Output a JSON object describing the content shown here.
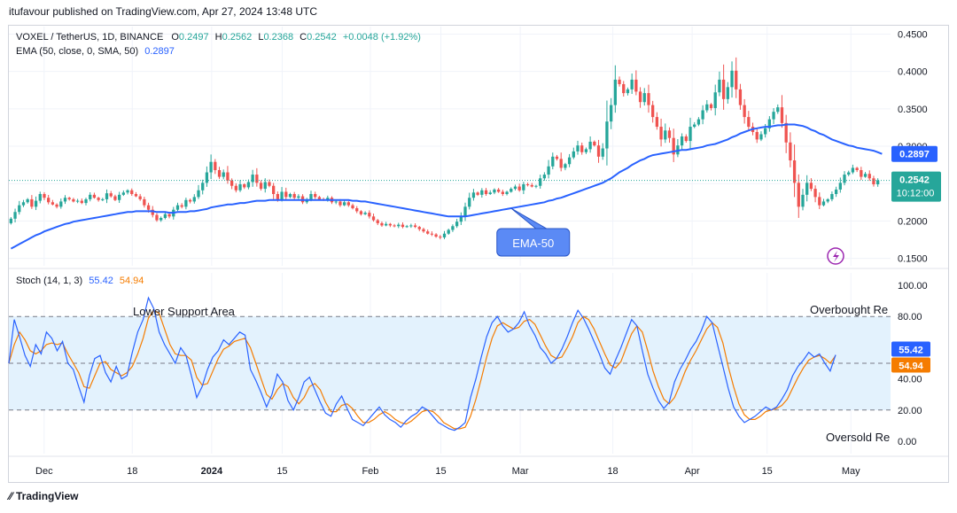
{
  "publisher": "itufavour published on TradingView.com, Apr 27, 2024 13:48 UTC",
  "footer": {
    "brand": "TradingView",
    "logo_icon": "tradingview-logo-icon"
  },
  "colors": {
    "up": "#26a69a",
    "down": "#ef5350",
    "ema": "#2962ff",
    "stoch_k": "#2962ff",
    "stoch_d": "#f57c00",
    "band_fill": "#e3f2fd"
  },
  "main_legend": {
    "symbol": "VOXEL / TetherUS, 1D, BINANCE",
    "open_label": "O",
    "open": "0.2497",
    "high_label": "H",
    "high": "0.2562",
    "low_label": "L",
    "low": "0.2368",
    "close_label": "C",
    "close": "0.2542",
    "change": "+0.0048 (+1.92%)",
    "ema_label": "EMA (50, close, 0, SMA, 50)",
    "ema_value": "0.2897"
  },
  "price_badges": {
    "ema": "0.2897",
    "last": "0.2542",
    "countdown": "10:12:00"
  },
  "annotation": {
    "ema_callout": "EMA-50"
  },
  "stoch_legend": {
    "label": "Stoch (14, 1, 3)",
    "k": "55.42",
    "d": "54.94"
  },
  "stoch_badges": {
    "k": "55.42",
    "d": "54.94"
  },
  "stoch_text": {
    "lower": "Lower Support Area",
    "overbought": "Overbought Re",
    "oversold": "Oversold Re"
  },
  "chart_data": [
    {
      "type": "candlestick",
      "title": "VOXEL / TetherUS, 1D, BINANCE",
      "y_axis": {
        "ticks": [
          "0.4500",
          "0.4000",
          "0.3500",
          "0.3000",
          "0.2500",
          "0.2000",
          "0.1500"
        ],
        "ylim": [
          0.14,
          0.46
        ]
      },
      "x_axis": {
        "ticks": [
          "Dec",
          "18",
          "2024",
          "15",
          "Feb",
          "15",
          "Mar",
          "18",
          "Apr",
          "15",
          "May"
        ]
      },
      "closes": [
        0.203,
        0.212,
        0.221,
        0.225,
        0.229,
        0.219,
        0.227,
        0.236,
        0.231,
        0.225,
        0.222,
        0.219,
        0.226,
        0.231,
        0.229,
        0.226,
        0.227,
        0.224,
        0.229,
        0.235,
        0.231,
        0.228,
        0.229,
        0.237,
        0.233,
        0.228,
        0.235,
        0.238,
        0.241,
        0.236,
        0.233,
        0.229,
        0.221,
        0.215,
        0.208,
        0.201,
        0.204,
        0.209,
        0.206,
        0.215,
        0.221,
        0.219,
        0.228,
        0.226,
        0.232,
        0.241,
        0.251,
        0.265,
        0.279,
        0.268,
        0.259,
        0.265,
        0.254,
        0.247,
        0.241,
        0.249,
        0.245,
        0.252,
        0.262,
        0.251,
        0.243,
        0.252,
        0.247,
        0.236,
        0.229,
        0.239,
        0.232,
        0.236,
        0.231,
        0.233,
        0.225,
        0.229,
        0.236,
        0.232,
        0.229,
        0.228,
        0.231,
        0.225,
        0.226,
        0.221,
        0.225,
        0.221,
        0.217,
        0.213,
        0.209,
        0.211,
        0.206,
        0.201,
        0.197,
        0.194,
        0.196,
        0.194,
        0.193,
        0.195,
        0.192,
        0.193,
        0.194,
        0.192,
        0.189,
        0.186,
        0.183,
        0.182,
        0.179,
        0.178,
        0.183,
        0.188,
        0.193,
        0.199,
        0.206,
        0.219,
        0.231,
        0.238,
        0.235,
        0.241,
        0.236,
        0.238,
        0.242,
        0.239,
        0.236,
        0.239,
        0.243,
        0.246,
        0.241,
        0.249,
        0.248,
        0.246,
        0.247,
        0.257,
        0.262,
        0.273,
        0.286,
        0.283,
        0.271,
        0.276,
        0.285,
        0.293,
        0.301,
        0.292,
        0.296,
        0.306,
        0.301,
        0.286,
        0.297,
        0.333,
        0.355,
        0.389,
        0.383,
        0.371,
        0.376,
        0.389,
        0.373,
        0.359,
        0.371,
        0.355,
        0.339,
        0.326,
        0.309,
        0.321,
        0.311,
        0.289,
        0.301,
        0.313,
        0.307,
        0.326,
        0.329,
        0.336,
        0.348,
        0.356,
        0.351,
        0.372,
        0.389,
        0.363,
        0.379,
        0.401,
        0.376,
        0.355,
        0.339,
        0.326,
        0.319,
        0.309,
        0.316,
        0.324,
        0.336,
        0.346,
        0.352,
        0.331,
        0.305,
        0.281,
        0.251,
        0.219,
        0.235,
        0.251,
        0.243,
        0.232,
        0.221,
        0.226,
        0.229,
        0.236,
        0.242,
        0.251,
        0.262,
        0.265,
        0.271,
        0.268,
        0.259,
        0.263,
        0.257,
        0.249,
        0.2542
      ],
      "ema50": [
        0.163,
        0.166,
        0.169,
        0.172,
        0.175,
        0.178,
        0.181,
        0.183,
        0.186,
        0.188,
        0.19,
        0.192,
        0.194,
        0.196,
        0.197,
        0.199,
        0.2,
        0.201,
        0.202,
        0.203,
        0.204,
        0.205,
        0.206,
        0.207,
        0.208,
        0.209,
        0.21,
        0.211,
        0.212,
        0.212,
        0.213,
        0.213,
        0.213,
        0.213,
        0.213,
        0.212,
        0.212,
        0.212,
        0.211,
        0.211,
        0.212,
        0.212,
        0.212,
        0.213,
        0.213,
        0.214,
        0.215,
        0.216,
        0.218,
        0.219,
        0.22,
        0.221,
        0.222,
        0.222,
        0.223,
        0.224,
        0.224,
        0.225,
        0.226,
        0.227,
        0.227,
        0.227,
        0.228,
        0.228,
        0.228,
        0.228,
        0.228,
        0.228,
        0.228,
        0.228,
        0.228,
        0.228,
        0.228,
        0.228,
        0.228,
        0.228,
        0.228,
        0.228,
        0.228,
        0.228,
        0.228,
        0.228,
        0.227,
        0.227,
        0.226,
        0.226,
        0.225,
        0.224,
        0.223,
        0.222,
        0.221,
        0.22,
        0.219,
        0.218,
        0.217,
        0.216,
        0.215,
        0.214,
        0.213,
        0.212,
        0.211,
        0.21,
        0.209,
        0.208,
        0.207,
        0.206,
        0.206,
        0.206,
        0.206,
        0.206,
        0.207,
        0.208,
        0.209,
        0.21,
        0.211,
        0.212,
        0.213,
        0.214,
        0.215,
        0.216,
        0.217,
        0.218,
        0.219,
        0.22,
        0.221,
        0.222,
        0.223,
        0.224,
        0.225,
        0.227,
        0.228,
        0.23,
        0.231,
        0.233,
        0.235,
        0.237,
        0.239,
        0.241,
        0.243,
        0.245,
        0.247,
        0.249,
        0.251,
        0.254,
        0.257,
        0.261,
        0.265,
        0.268,
        0.271,
        0.275,
        0.278,
        0.281,
        0.283,
        0.286,
        0.288,
        0.289,
        0.29,
        0.291,
        0.292,
        0.293,
        0.294,
        0.295,
        0.295,
        0.296,
        0.297,
        0.298,
        0.299,
        0.301,
        0.302,
        0.303,
        0.305,
        0.307,
        0.309,
        0.312,
        0.314,
        0.317,
        0.319,
        0.321,
        0.323,
        0.324,
        0.325,
        0.326,
        0.326,
        0.327,
        0.328,
        0.328,
        0.329,
        0.329,
        0.329,
        0.328,
        0.327,
        0.325,
        0.322,
        0.32,
        0.317,
        0.315,
        0.312,
        0.309,
        0.307,
        0.305,
        0.303,
        0.301,
        0.3,
        0.298,
        0.297,
        0.296,
        0.295,
        0.294,
        0.292,
        0.2897
      ]
    },
    {
      "type": "line",
      "title": "Stoch (14, 1, 3)",
      "y_axis": {
        "ticks": [
          "100.00",
          "80.00",
          "60.00",
          "40.00",
          "20.00",
          "0.00"
        ],
        "ylim": [
          -5,
          105
        ]
      },
      "bands": {
        "upper": 80,
        "middle": 50,
        "lower": 20
      },
      "series": [
        {
          "name": "K",
          "values": [
            50,
            78,
            67,
            55,
            48,
            62,
            56,
            70,
            66,
            58,
            64,
            50,
            46,
            35,
            25,
            42,
            53,
            55,
            44,
            38,
            48,
            40,
            42,
            57,
            70,
            78,
            92,
            85,
            70,
            62,
            56,
            50,
            60,
            55,
            42,
            28,
            35,
            46,
            54,
            58,
            65,
            62,
            66,
            70,
            68,
            46,
            39,
            31,
            22,
            30,
            43,
            38,
            26,
            20,
            28,
            38,
            41,
            33,
            25,
            18,
            16,
            24,
            29,
            21,
            14,
            12,
            10,
            14,
            18,
            22,
            17,
            14,
            12,
            9,
            13,
            16,
            18,
            22,
            20,
            16,
            12,
            10,
            8,
            7,
            9,
            12,
            28,
            40,
            54,
            67,
            76,
            80,
            74,
            70,
            72,
            76,
            83,
            74,
            68,
            60,
            56,
            50,
            53,
            59,
            67,
            76,
            84,
            79,
            72,
            64,
            56,
            47,
            43,
            52,
            60,
            69,
            78,
            74,
            58,
            43,
            34,
            26,
            21,
            25,
            38,
            46,
            52,
            59,
            64,
            71,
            80,
            76,
            62,
            48,
            34,
            22,
            16,
            12,
            14,
            16,
            19,
            22,
            20,
            22,
            27,
            33,
            42,
            48,
            52,
            57,
            54,
            56,
            50,
            45,
            55.42
          ]
        },
        {
          "name": "D",
          "values": [
            50,
            62,
            70,
            65,
            58,
            56,
            58,
            62,
            63,
            62,
            63,
            56,
            50,
            44,
            35,
            34,
            42,
            50,
            51,
            46,
            44,
            42,
            44,
            48,
            56,
            66,
            79,
            84,
            82,
            72,
            62,
            56,
            55,
            55,
            52,
            41,
            36,
            37,
            45,
            53,
            59,
            61,
            64,
            65,
            66,
            60,
            50,
            40,
            30,
            27,
            33,
            37,
            35,
            28,
            24,
            28,
            35,
            37,
            33,
            25,
            19,
            19,
            23,
            24,
            21,
            16,
            12,
            12,
            14,
            17,
            19,
            17,
            14,
            12,
            11,
            13,
            16,
            19,
            20,
            19,
            16,
            12,
            10,
            8,
            8,
            9,
            16,
            27,
            40,
            54,
            66,
            74,
            76,
            74,
            72,
            73,
            77,
            78,
            75,
            68,
            61,
            55,
            53,
            54,
            60,
            67,
            76,
            80,
            78,
            72,
            64,
            56,
            49,
            47,
            51,
            60,
            69,
            74,
            70,
            58,
            45,
            35,
            27,
            24,
            28,
            36,
            45,
            52,
            58,
            65,
            72,
            76,
            73,
            63,
            48,
            35,
            24,
            17,
            14,
            14,
            16,
            19,
            20,
            21,
            23,
            27,
            34,
            41,
            47,
            52,
            54,
            55,
            53,
            50,
            54.94
          ]
        }
      ]
    }
  ]
}
